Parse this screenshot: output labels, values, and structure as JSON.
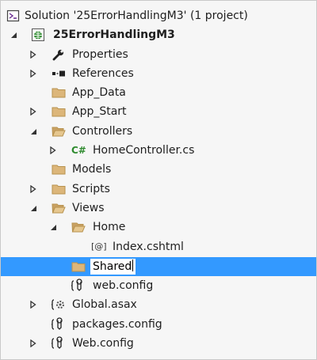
{
  "explorer": {
    "solution_label": "Solution '25ErrorHandlingM3' (1 project)",
    "project_label": "25ErrorHandlingM3",
    "items": {
      "properties": "Properties",
      "references": "References",
      "app_data": "App_Data",
      "app_start": "App_Start",
      "controllers": "Controllers",
      "home_controller": "HomeController.cs",
      "models": "Models",
      "scripts": "Scripts",
      "views": "Views",
      "home": "Home",
      "index": "Index.cshtml",
      "shared_edit_value": "Shared",
      "views_webconfig": "web.config",
      "global_asax": "Global.asax",
      "packages_config": "packages.config",
      "root_webconfig": "Web.config"
    }
  },
  "colors": {
    "selection": "#3399ff",
    "folder": "#dcb67a",
    "background": "#f6f6f6"
  }
}
